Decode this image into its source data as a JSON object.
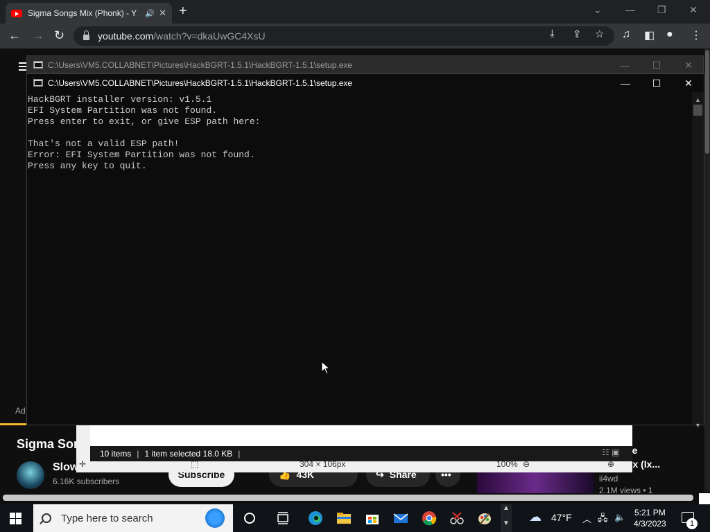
{
  "browser": {
    "tab_title": "Sigma Songs Mix (Phonk) - Y",
    "url_host": "youtube.com",
    "url_path": "/watch?v=dkaUwGC4XsU"
  },
  "youtube": {
    "ad_label": "Ad",
    "video_title": "Sigma Son",
    "channel_name": "Slow",
    "subscribers": "6.16K subscribers",
    "subscribe_label": "Subscribe",
    "likes": "43K",
    "share_label": "Share",
    "more_label": "•••",
    "side_title_1": "ive",
    "side_title_2": "nix (lx...",
    "side_channel": "ii4wd",
    "side_views": "2.1M views • 1"
  },
  "explorer": {
    "items": "10 items",
    "selected": "1 item selected  18.0 KB",
    "dimensions": "304 × 106px",
    "zoom": "100%"
  },
  "console_back": {
    "title": "C:\\Users\\VM5.COLLABNET\\Pictures\\HackBGRT-1.5.1\\HackBGRT-1.5.1\\setup.exe"
  },
  "console": {
    "title": "C:\\Users\\VM5.COLLABNET\\Pictures\\HackBGRT-1.5.1\\HackBGRT-1.5.1\\setup.exe",
    "output": "HackBGRT installer version: v1.5.1\nEFI System Partition was not found.\nPress enter to exit, or give ESP path here:\n\nThat's not a valid ESP path!\nError: EFI System Partition was not found.\nPress any key to quit."
  },
  "taskbar": {
    "search_placeholder": "Type here to search",
    "temperature": "47°F",
    "time": "5:21 PM",
    "date": "4/3/2023",
    "notification_count": "1"
  },
  "icons": {
    "taskbar": [
      "cortana-icon",
      "task-view-icon",
      "edge-icon",
      "file-explorer-icon",
      "store-icon",
      "mail-icon",
      "chrome-icon",
      "snipping-tool-icon",
      "paint-icon"
    ]
  }
}
